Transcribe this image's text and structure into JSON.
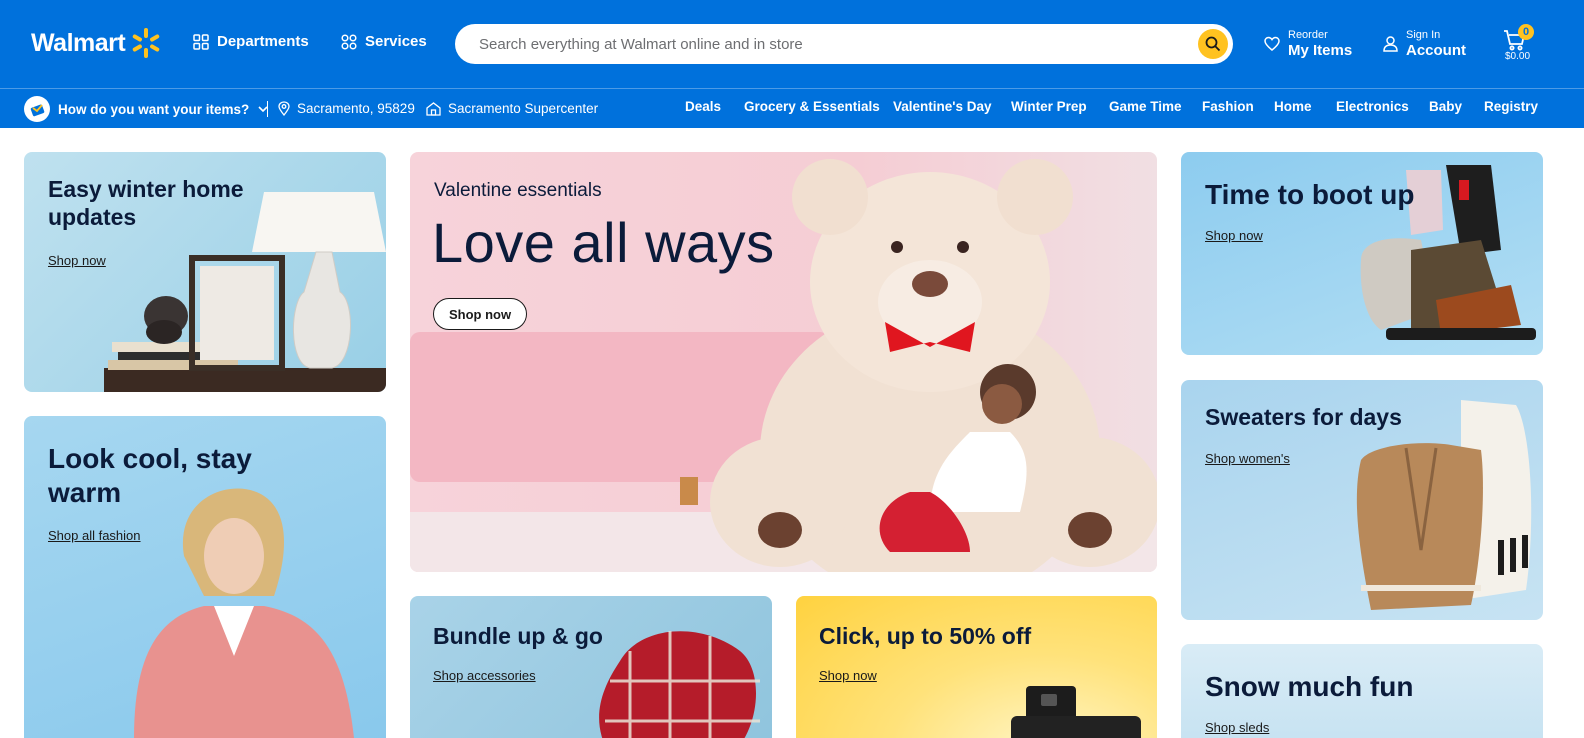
{
  "header": {
    "logo_text": "Walmart",
    "departments_label": "Departments",
    "services_label": "Services",
    "search_placeholder": "Search everything at Walmart online and in store",
    "reorder_small": "Reorder",
    "reorder_big": "My Items",
    "signin_small": "Sign In",
    "signin_big": "Account",
    "cart_count": "0",
    "cart_total": "$0.00",
    "brand_color": "#0071dc",
    "accent_color": "#ffc220"
  },
  "subbar": {
    "fulfillment_label": "How do you want your items?",
    "zip_label": "Sacramento, 95829",
    "store_label": "Sacramento Supercenter",
    "categories": [
      "Deals",
      "Grocery & Essentials",
      "Valentine's Day",
      "Winter Prep",
      "Game Time",
      "Fashion",
      "Home",
      "Electronics",
      "Baby",
      "Registry"
    ]
  },
  "cards": {
    "winter": {
      "title": "Easy winter home updates",
      "link": "Shop now"
    },
    "fashion": {
      "title": "Look cool, stay warm",
      "link": "Shop all fashion"
    },
    "hero": {
      "eyebrow": "Valentine essentials",
      "title": "Love all ways",
      "button": "Shop now"
    },
    "bundle": {
      "title": "Bundle up & go",
      "link": "Shop accessories"
    },
    "click": {
      "title": "Click, up to 50% off",
      "link": "Shop now"
    },
    "boots": {
      "title": "Time to boot up",
      "link": "Shop now"
    },
    "sweater": {
      "title": "Sweaters for days",
      "link": "Shop women's"
    },
    "snow": {
      "title": "Snow much fun",
      "link": "Shop sleds"
    }
  },
  "icons": [
    "spark-logo-icon",
    "grid-icon",
    "services-icon",
    "search-icon",
    "heart-icon",
    "user-icon",
    "cart-icon",
    "fulfillment-icon",
    "chevron-down-icon",
    "location-pin-icon",
    "store-icon"
  ]
}
